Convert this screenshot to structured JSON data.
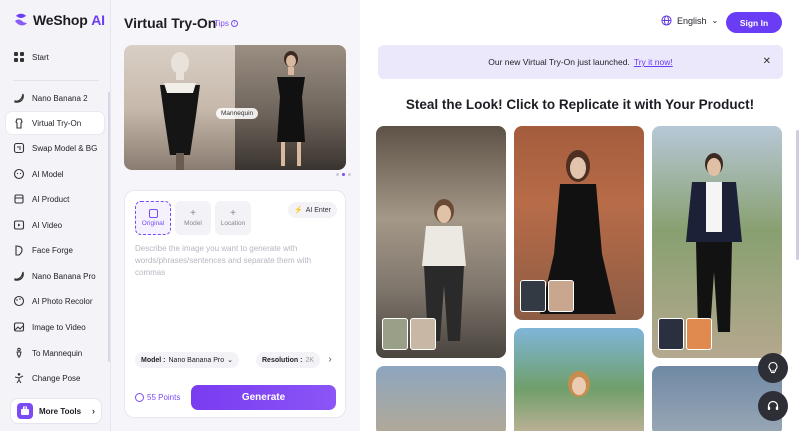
{
  "app": {
    "name_prefix": "WeShop",
    "name_suffix": "AI"
  },
  "sidebar": {
    "start": "Start",
    "items": [
      {
        "label": "Nano Banana 2",
        "icon": "banana-icon"
      },
      {
        "label": "Virtual Try-On",
        "icon": "hanger-icon",
        "active": true
      },
      {
        "label": "Swap Model & BG",
        "icon": "swap-icon"
      },
      {
        "label": "AI Model",
        "icon": "face-icon"
      },
      {
        "label": "AI Product",
        "icon": "product-icon"
      },
      {
        "label": "AI Video",
        "icon": "video-icon"
      },
      {
        "label": "Face Forge",
        "icon": "face-forge-icon"
      },
      {
        "label": "Nano Banana Pro",
        "icon": "banana-icon"
      },
      {
        "label": "AI Photo Recolor",
        "icon": "palette-icon"
      },
      {
        "label": "Image to Video",
        "icon": "image-video-icon"
      },
      {
        "label": "To Mannequin",
        "icon": "mannequin-icon"
      },
      {
        "label": "Change Pose",
        "icon": "pose-icon"
      }
    ],
    "more_tools": "More Tools"
  },
  "panel": {
    "title": "Virtual Try-On",
    "tips": "Tips",
    "mannequin_label": "Mannequin",
    "chips": [
      "Original",
      "Model",
      "Location"
    ],
    "ai_enter": "AI Enter",
    "prompt_placeholder": "Describe the image you want to generate with words/phrases/sentences and separate them with commas",
    "model_label": "Model :",
    "model_value": "Nano Banana Pro",
    "resolution_label": "Resolution :",
    "resolution_value": "2K",
    "points": "55 Points",
    "generate": "Generate"
  },
  "header": {
    "language": "English",
    "sign_in": "Sign In"
  },
  "banner": {
    "text": "Our new Virtual Try-On just launched.",
    "link": "Try it now!"
  },
  "gallery": {
    "headline": "Steal the Look! Click to Replicate it with Your Product!"
  },
  "colors": {
    "accent": "#6b3cf5",
    "banner_bg": "#ece8fb"
  }
}
